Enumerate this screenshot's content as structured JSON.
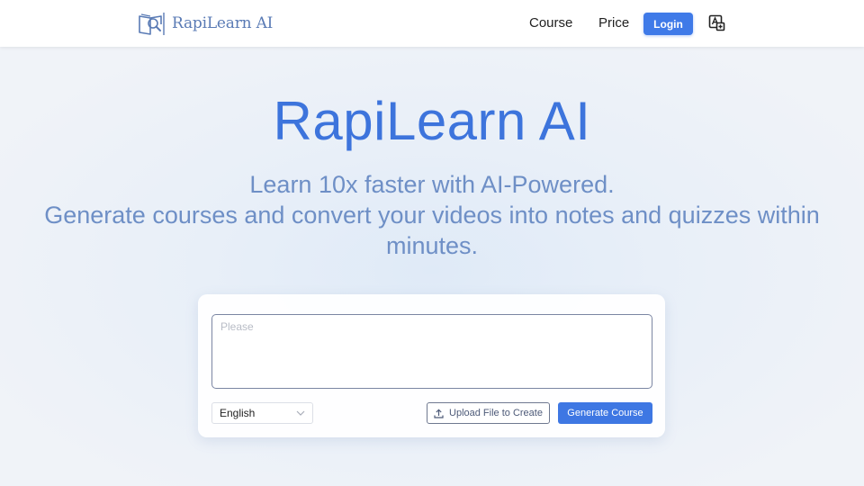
{
  "nav": {
    "brand_name": "RapiLearn AI",
    "links": [
      "Course",
      "Price"
    ],
    "login_label": "Login"
  },
  "hero": {
    "title": "RapiLearn AI",
    "subtitle_line1": "Learn 10x faster with AI-Powered.",
    "subtitle_line2": "Generate courses and convert your videos into notes and quizzes within minutes."
  },
  "form": {
    "prompt_placeholder": "Please",
    "prompt_value": "",
    "language_selected": "English",
    "upload_label": "Upload File to Create",
    "generate_label": "Generate Course"
  },
  "colors": {
    "accent": "#3f7ae8",
    "title": "#3d74dc",
    "subtitle": "#6e8fc6"
  },
  "icons": {
    "brand": "book-magnifier-icon",
    "translate": "translate-icon",
    "chevron": "chevron-down-icon",
    "upload": "upload-icon"
  }
}
